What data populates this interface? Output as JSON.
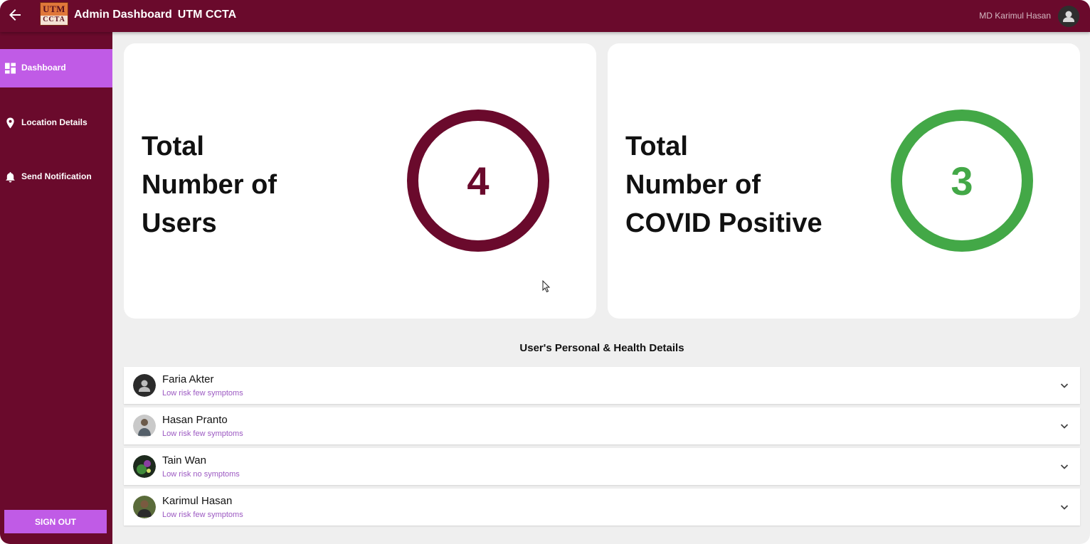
{
  "header": {
    "title": "Admin Dashboard",
    "subtitle": "UTM CCTA",
    "logo_line1": "UTM",
    "logo_line2": "CCTA",
    "user_name": "MD Karimul Hasan",
    "bar_color": "#6a0a2c"
  },
  "sidebar": {
    "items": [
      {
        "label": "Dashboard",
        "icon": "dashboard-icon",
        "active": true
      },
      {
        "label": "Location Details",
        "icon": "location-pin-icon",
        "active": false
      },
      {
        "label": "Send Notification",
        "icon": "bell-icon",
        "active": false
      }
    ],
    "sign_out_label": "SIGN OUT",
    "accent_color": "#c05be6"
  },
  "stats": {
    "users": {
      "title_lines": [
        "Total",
        "Number of",
        "Users"
      ],
      "value": "4",
      "color": "#6a0a2c"
    },
    "covid": {
      "title_lines": [
        "Total",
        "Number of",
        "COVID Positive"
      ],
      "value": "3",
      "color": "#43a847"
    }
  },
  "details": {
    "title": "User's Personal & Health Details",
    "users": [
      {
        "name": "Faria Akter",
        "status": "Low risk few symptoms",
        "avatar": "default-avatar"
      },
      {
        "name": "Hasan Pranto",
        "status": "Low risk few symptoms",
        "avatar": "photo-avatar"
      },
      {
        "name": "Tain Wan",
        "status": "Low risk no symptoms",
        "avatar": "photo-avatar"
      },
      {
        "name": "Karimul Hasan",
        "status": "Low risk few symptoms",
        "avatar": "photo-avatar"
      }
    ]
  }
}
